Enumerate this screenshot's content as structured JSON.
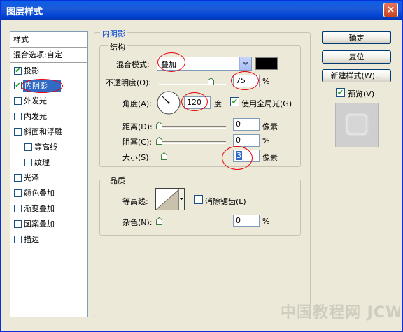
{
  "window": {
    "title": "图层样式",
    "close_symbol": "×"
  },
  "sidebar": {
    "header": "样式",
    "blend_options": "混合选项:自定",
    "items": [
      {
        "label": "投影",
        "checked": true,
        "check": "✔"
      },
      {
        "label": "内阴影",
        "checked": true,
        "check": "✔",
        "selected": true
      },
      {
        "label": "外发光",
        "checked": false
      },
      {
        "label": "内发光",
        "checked": false
      },
      {
        "label": "斜面和浮雕",
        "checked": false
      },
      {
        "label": "等高线",
        "checked": false
      },
      {
        "label": "纹理",
        "checked": false
      },
      {
        "label": "光泽",
        "checked": false
      },
      {
        "label": "颜色叠加",
        "checked": false
      },
      {
        "label": "渐变叠加",
        "checked": false
      },
      {
        "label": "图案叠加",
        "checked": false
      },
      {
        "label": "描边",
        "checked": false
      }
    ]
  },
  "inner_shadow": {
    "group_title": "内阴影",
    "structure": {
      "title": "结构",
      "blend_mode_label": "混合模式:",
      "blend_mode_value": "叠加",
      "blend_color": "#000000",
      "opacity_label": "不透明度(O):",
      "opacity_value": "75",
      "opacity_unit": "%",
      "angle_label": "角度(A):",
      "angle_value": "120",
      "angle_unit": "度",
      "global_light_label": "使用全局光(G)",
      "global_light_checked": true,
      "distance_label": "距离(D):",
      "distance_value": "0",
      "distance_unit": "像素",
      "choke_label": "阻塞(C):",
      "choke_value": "0",
      "choke_unit": "%",
      "size_label": "大小(S):",
      "size_value": "3",
      "size_unit": "像素"
    },
    "quality": {
      "title": "品质",
      "contour_label": "等高线:",
      "antialias_label": "消除锯齿(L)",
      "antialias_checked": false,
      "noise_label": "杂色(N):",
      "noise_value": "0",
      "noise_unit": "%"
    }
  },
  "buttons": {
    "ok": "确定",
    "reset": "复位",
    "new_style": "新建样式(W)...",
    "preview_label": "预览(V)",
    "preview_checked": true
  },
  "watermark": "中国教程网 JCWcn.com",
  "colors": {
    "title_bar": "#0A5FEA",
    "selection": "#316AC5",
    "annotation_ring": "#E8000B",
    "group_label": "#0046D5"
  }
}
